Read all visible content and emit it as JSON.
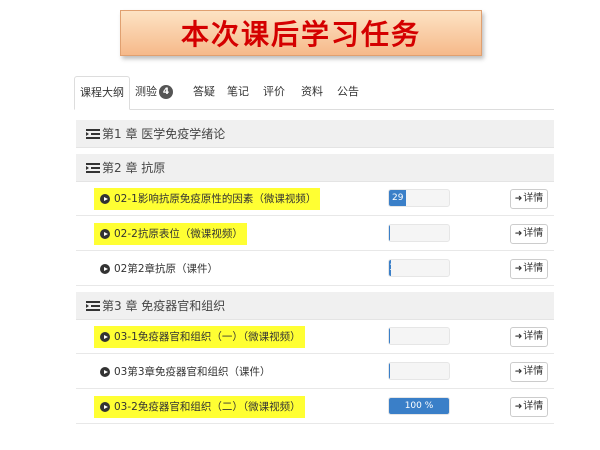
{
  "banner": {
    "title": "本次课后学习任务"
  },
  "tabs": [
    {
      "label": "课程大纲",
      "active": true
    },
    {
      "label": "测验",
      "badge": "4"
    },
    {
      "label": "答疑"
    },
    {
      "label": "笔记"
    },
    {
      "label": "评价"
    },
    {
      "label": "资料"
    },
    {
      "label": "公告"
    }
  ],
  "chapters": [
    {
      "title": "第1 章 医学免疫学绪论",
      "lessons": []
    },
    {
      "title": "第2 章 抗原",
      "lessons": [
        {
          "title": "02-1影响抗原免疫原性的因素（微课视频）",
          "highlighted": true,
          "progress_percent": 29,
          "progress_label": "29",
          "detail_label": "详情"
        },
        {
          "title": "02-2抗原表位（微课视频）",
          "highlighted": true,
          "progress_percent": 0,
          "progress_label": "",
          "detail_label": "详情"
        },
        {
          "title": "02第2章抗原（课件）",
          "highlighted": false,
          "progress_percent": 1,
          "progress_label": "1",
          "detail_label": "详情"
        }
      ]
    },
    {
      "title": "第3 章 免疫器官和组织",
      "lessons": [
        {
          "title": "03-1免疫器官和组织（一）（微课视频）",
          "highlighted": true,
          "progress_percent": 0,
          "progress_label": "",
          "detail_label": "详情"
        },
        {
          "title": "03第3章免疫器官和组织（课件）",
          "highlighted": false,
          "progress_percent": 0,
          "progress_label": "",
          "detail_label": "详情"
        },
        {
          "title": "03-2免疫器官和组织（二）（微课视频）",
          "highlighted": true,
          "progress_percent": 100,
          "progress_label": "100 %",
          "detail_label": "详情"
        }
      ]
    }
  ],
  "colors": {
    "banner_text": "#d40000",
    "highlight": "#ffff33",
    "progress": "#3a7fc8"
  },
  "icons": {
    "chapter": "list-indent-icon",
    "lesson": "play-circle-icon",
    "detail": "sign-in-icon"
  }
}
